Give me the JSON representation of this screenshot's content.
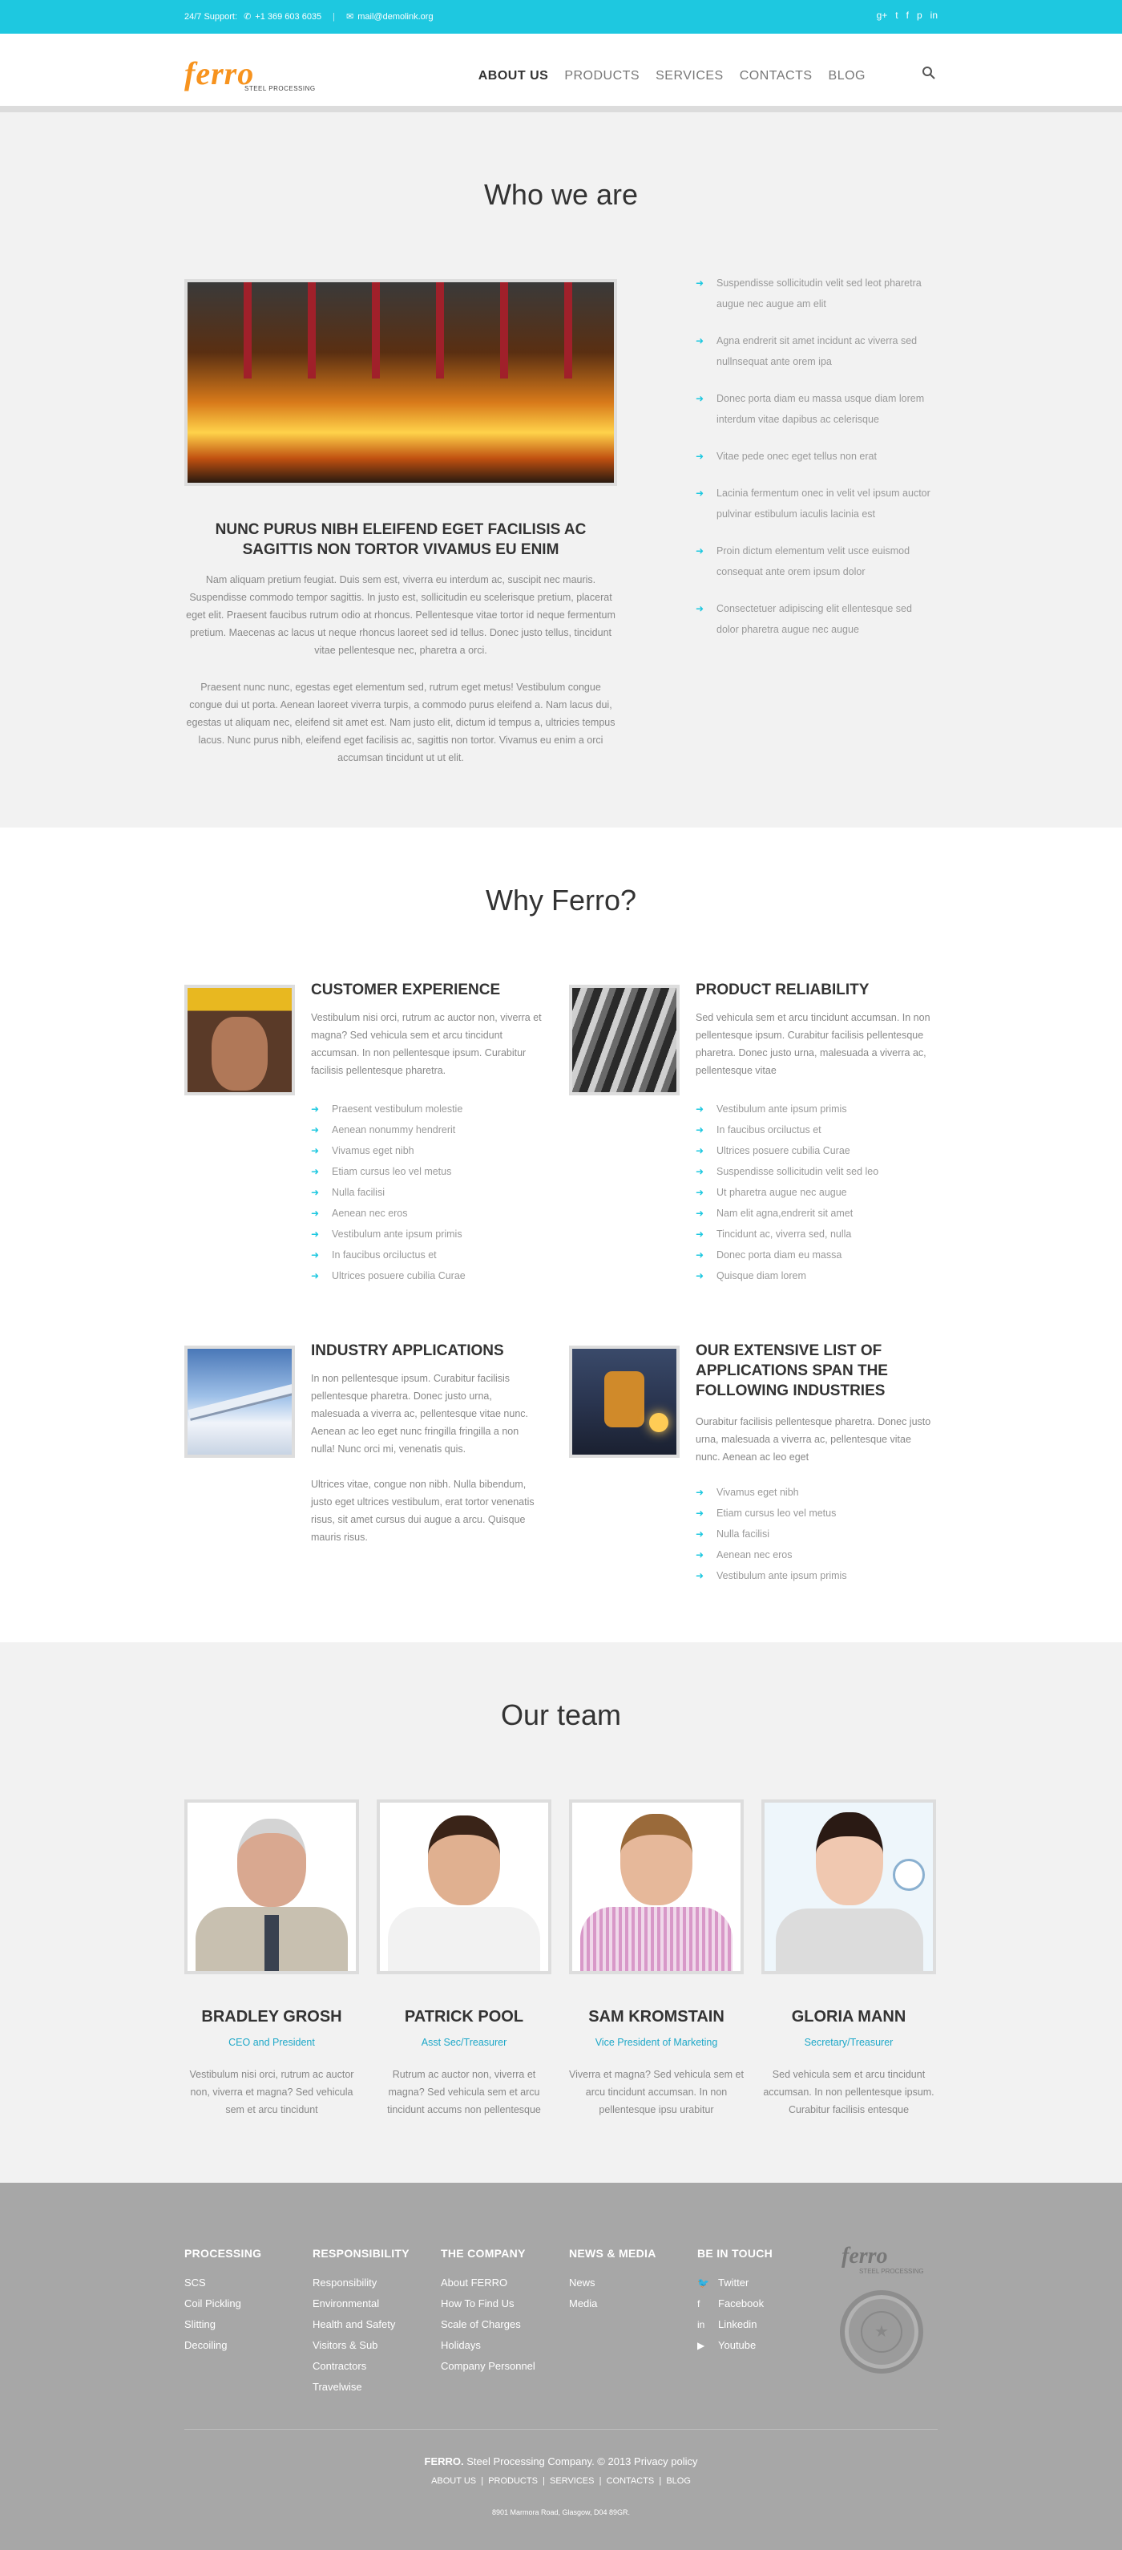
{
  "topbar": {
    "support_label": "24/7 Support:",
    "phone": "+1 369 603 6035",
    "email": "mail@demolink.org",
    "social": [
      "g+",
      "t",
      "f",
      "p",
      "in"
    ]
  },
  "header": {
    "logo": "ferro",
    "logo_sub": "STEEL PROCESSING",
    "nav": [
      "ABOUT US",
      "PRODUCTS",
      "SERVICES",
      "CONTACTS",
      "BLOG"
    ]
  },
  "about": {
    "heading": "Who we are",
    "title": "NUNC PURUS NIBH ELEIFEND EGET FACILISIS AC SAGITTIS NON TORTOR VIVAMUS EU ENIM",
    "p1": "Nam aliquam pretium feugiat. Duis sem est, viverra eu interdum ac, suscipit nec mauris. Suspendisse commodo tempor sagittis. In justo est, sollicitudin eu scelerisque pretium, placerat eget elit. Praesent faucibus rutrum odio at rhoncus. Pellentesque vitae tortor id neque fermentum pretium. Maecenas ac lacus ut neque rhoncus laoreet sed id tellus. Donec justo tellus, tincidunt vitae pellentesque nec, pharetra a orci.",
    "p2": "Praesent nunc nunc, egestas eget elementum sed, rutrum eget metus! Vestibulum congue congue dui ut porta. Aenean laoreet viverra turpis, a commodo purus eleifend a. Nam lacus dui, egestas ut aliquam nec, eleifend sit amet est. Nam justo elit, dictum id tempus a, ultricies tempus lacus. Nunc purus nibh, eleifend eget facilisis ac, sagittis non tortor. Vivamus eu enim a orci accumsan tincidunt ut ut elit.",
    "list": [
      "Suspendisse sollicitudin velit sed leot pharetra augue nec augue am elit",
      "Agna endrerit sit amet incidunt ac viverra sed nullnsequat ante orem ipa",
      "Donec porta diam eu massa usque diam lorem interdum vitae dapibus ac celerisque",
      "Vitae pede onec eget tellus non erat",
      "Lacinia fermentum onec in velit vel ipsum auctor pulvinar estibulum iaculis lacinia est",
      "Proin dictum elementum velit usce euismod consequat ante orem ipsum dolor",
      "Consectetuer adipiscing elit ellentesque sed dolor pharetra augue nec augue"
    ]
  },
  "why": {
    "heading": "Why Ferro?",
    "f1": {
      "title": "CUSTOMER EXPERIENCE",
      "text": "Vestibulum nisi orci, rutrum ac auctor non, viverra et magna? Sed vehicula sem et arcu tincidunt accumsan. In non pellentesque ipsum. Curabitur facilisis pellentesque pharetra.",
      "list": [
        "Praesent vestibulum molestie",
        "Aenean nonummy hendrerit",
        "Vivamus eget nibh",
        "Etiam cursus leo vel metus",
        "Nulla facilisi",
        "Aenean nec eros",
        "Vestibulum ante ipsum primis",
        "In faucibus orciluctus et",
        "Ultrices posuere cubilia Curae"
      ]
    },
    "f2": {
      "title": "PRODUCT RELIABILITY",
      "text": "Sed vehicula sem et arcu tincidunt accumsan. In non pellentesque ipsum. Curabitur facilisis pellentesque pharetra. Donec justo urna, malesuada a viverra ac, pellentesque vitae",
      "list": [
        "Vestibulum ante ipsum primis",
        "In faucibus orciluctus et",
        "Ultrices posuere cubilia Curae",
        "Suspendisse sollicitudin velit sed leo",
        "Ut pharetra augue nec augue",
        "Nam elit agna,endrerit sit amet",
        "Tincidunt ac, viverra sed, nulla",
        "Donec porta diam eu massa",
        "Quisque diam lorem"
      ]
    },
    "f3": {
      "title": "INDUSTRY APPLICATIONS",
      "text": "In non pellentesque ipsum. Curabitur facilisis pellentesque pharetra. Donec justo urna, malesuada a viverra ac, pellentesque vitae nunc. Aenean ac leo eget nunc fringilla fringilla a non nulla! Nunc orci mi, venenatis quis.",
      "text2": "Ultrices vitae, congue non nibh. Nulla bibendum, justo eget ultrices vestibulum, erat tortor venenatis risus, sit amet cursus dui augue a arcu. Quisque mauris risus."
    },
    "f4": {
      "title": "OUR EXTENSIVE LIST OF APPLICATIONS SPAN THE FOLLOWING INDUSTRIES",
      "text": "Ourabitur facilisis pellentesque pharetra. Donec justo urna, malesuada a viverra ac, pellentesque vitae nunc. Aenean ac leo eget",
      "list": [
        "Vivamus eget nibh",
        "Etiam cursus leo vel metus",
        "Nulla facilisi",
        "Aenean nec eros",
        "Vestibulum ante ipsum primis"
      ]
    }
  },
  "team": {
    "heading": "Our team",
    "members": [
      {
        "name": "BRADLEY GROSH",
        "role": "CEO and President",
        "bio": "Vestibulum nisi orci, rutrum ac auctor non, viverra et magna? Sed vehicula sem et arcu tincidunt"
      },
      {
        "name": "PATRICK POOL",
        "role": "Asst Sec/Treasurer",
        "bio": "Rutrum ac auctor non, viverra et magna? Sed vehicula sem et arcu tincidunt accums non pellentesque"
      },
      {
        "name": "SAM KROMSTAIN",
        "role": "Vice President of Marketing",
        "bio": "Viverra et magna? Sed vehicula sem et arcu tincidunt accumsan. In non pellentesque ipsu urabitur"
      },
      {
        "name": "GLORIA MANN",
        "role": "Secretary/Treasurer",
        "bio": "Sed vehicula sem et arcu tincidunt accumsan. In non pellentesque ipsum. Curabitur facilisis entesque"
      }
    ]
  },
  "footer": {
    "cols": [
      {
        "title": "PROCESSING",
        "items": [
          "SCS",
          "Coil Pickling",
          "Slitting",
          "Decoiling"
        ]
      },
      {
        "title": "RESPONSIBILITY",
        "items": [
          "Responsibility",
          "Environmental",
          "Health and Safety",
          "Visitors & Sub",
          "Contractors",
          "Travelwise"
        ]
      },
      {
        "title": "THE COMPANY",
        "items": [
          "About FERRO",
          "How To Find Us",
          "Scale of Charges",
          "Holidays",
          "Company Personnel"
        ]
      },
      {
        "title": "NEWS & MEDIA",
        "items": [
          "News",
          "Media"
        ]
      },
      {
        "title": "BE IN TOUCH",
        "items": [
          "Twitter",
          "Facebook",
          "Linkedin",
          "Youtube"
        ]
      }
    ],
    "logo": "ferro",
    "logo_sub": "STEEL PROCESSING",
    "copy_brand": "FERRO.",
    "copy_rest": " Steel Processing Company. © 2013 Privacy policy",
    "nav": [
      "ABOUT US",
      "PRODUCTS",
      "SERVICES",
      "CONTACTS",
      "BLOG"
    ],
    "address": "8901 Marmora Road, Glasgow, D04 89GR."
  },
  "colors": {
    "accent": "#1ec8e0",
    "brand": "#f7931e",
    "footer": "#a7a7a7"
  }
}
